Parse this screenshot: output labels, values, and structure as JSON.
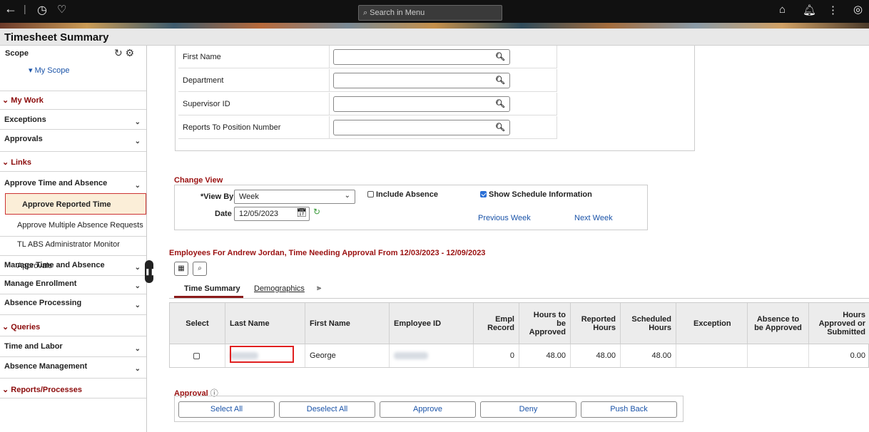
{
  "topbar": {
    "search_placeholder": "Search in Menu"
  },
  "page_title": "Timesheet Summary",
  "sidebar": {
    "scope_title": "Scope",
    "my_scope": "▾ My Scope",
    "sections": {
      "my_work": "My Work",
      "links": "Links",
      "queries": "Queries",
      "reports": "Reports/Processes"
    },
    "items": {
      "exceptions": "Exceptions",
      "approvals": "Approvals",
      "approve_time_absence": "Approve Time and Absence",
      "approve_reported_time": "Approve Reported Time",
      "approve_multiple_absence": "Approve Multiple Absence Requests",
      "tl_abs_admin": "TL ABS Administrator Monitor Approvals",
      "manage_time_absence": "Manage Time and Absence",
      "manage_enrollment": "Manage Enrollment",
      "absence_processing": "Absence Processing",
      "time_and_labor": "Time and Labor",
      "absence_management": "Absence Management"
    }
  },
  "search_fields": [
    "First Name",
    "Department",
    "Supervisor ID",
    "Reports To Position Number"
  ],
  "change_view": {
    "title": "Change View",
    "view_by_label": "*View By",
    "view_by_value": "Week",
    "date_label": "Date",
    "date_value": "12/05/2023",
    "include_absence": "Include Absence",
    "show_schedule": "Show Schedule Information",
    "previous_week": "Previous Week",
    "next_week": "Next Week"
  },
  "employees_title": "Employees For Andrew Jordan, Time Needing Approval From 12/03/2023 - 12/09/2023",
  "tabs": [
    "Time Summary",
    "Demographics"
  ],
  "grid": {
    "headers": {
      "select": "Select",
      "last_name": "Last Name",
      "first_name": "First Name",
      "employee_id": "Employee ID",
      "empl_record": "Empl Record",
      "hours_to_approve": "Hours to be Approved",
      "reported_hours": "Reported Hours",
      "scheduled_hours": "Scheduled Hours",
      "exception": "Exception",
      "absence_to_approve": "Absence to be Approved",
      "hours_approved": "Hours Approved or Submitted"
    },
    "row": {
      "first_name": "George",
      "empl_record": "0",
      "hours_to_approve": "48.00",
      "reported_hours": "48.00",
      "scheduled_hours": "48.00",
      "hours_approved": "0.00"
    }
  },
  "approval": {
    "title": "Approval",
    "buttons": {
      "select_all": "Select All",
      "deselect_all": "Deselect All",
      "approve": "Approve",
      "deny": "Deny",
      "push_back": "Push Back"
    }
  }
}
